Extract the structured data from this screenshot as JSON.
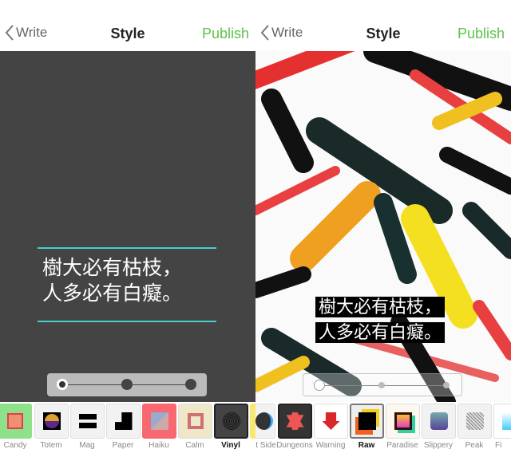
{
  "left": {
    "nav": {
      "back_label": "Write",
      "title": "Style",
      "publish_label": "Publish"
    },
    "quote": {
      "line1": "樹大必有枯枝，",
      "line2": "人多必有白癡。"
    },
    "slider": {
      "positions": 3,
      "selected": 0
    },
    "styles": [
      {
        "label": "Candy",
        "selected": false
      },
      {
        "label": "Totem",
        "selected": false
      },
      {
        "label": "Mag",
        "selected": false
      },
      {
        "label": "Paper",
        "selected": false
      },
      {
        "label": "Haiku",
        "selected": false
      },
      {
        "label": "Calm",
        "selected": false
      },
      {
        "label": "Vinyl",
        "selected": true
      }
    ]
  },
  "right": {
    "nav": {
      "back_label": "Write",
      "title": "Style",
      "publish_label": "Publish"
    },
    "quote": {
      "line1": "樹大必有枯枝，",
      "line2": "人多必有白癡。"
    },
    "slider": {
      "positions": 3,
      "selected": 0
    },
    "styles": [
      {
        "label": "t Side",
        "selected": false
      },
      {
        "label": "Dungeons",
        "selected": false
      },
      {
        "label": "Warning",
        "selected": false
      },
      {
        "label": "Raw",
        "selected": true
      },
      {
        "label": "Paradise",
        "selected": false
      },
      {
        "label": "Slippery",
        "selected": false
      },
      {
        "label": "Peak",
        "selected": false
      },
      {
        "label": "Fi",
        "selected": false
      }
    ]
  },
  "colors": {
    "accent": "#5cc34a",
    "rule": "#45d0c8",
    "dark_bg": "#444444"
  }
}
